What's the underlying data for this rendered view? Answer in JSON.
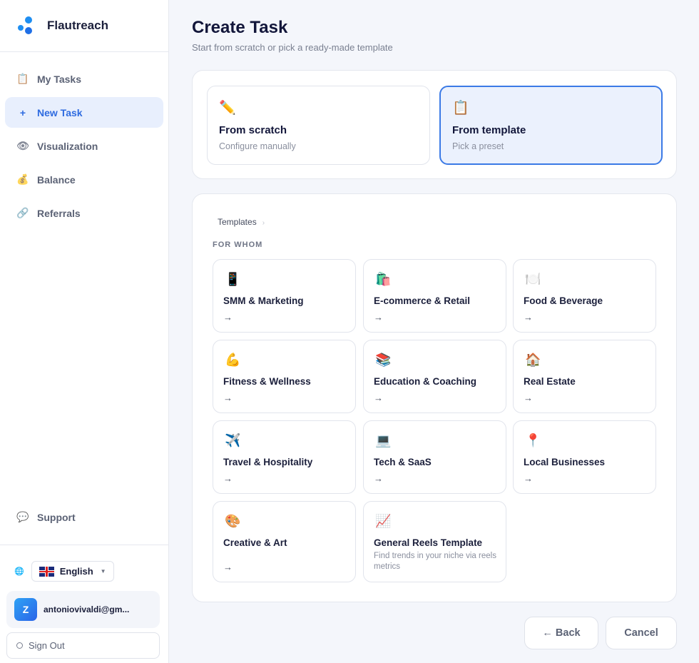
{
  "brand": {
    "name": "Flautreach"
  },
  "sidebar": {
    "items": [
      {
        "label": "My Tasks",
        "icon": "clipboard-icon",
        "glyph": "📋"
      },
      {
        "label": "New Task",
        "icon": "plus-icon",
        "glyph": "+"
      },
      {
        "label": "Visualization",
        "icon": "eye-icon",
        "glyph": "👁"
      },
      {
        "label": "Balance",
        "icon": "money-bag-icon",
        "glyph": "💰"
      },
      {
        "label": "Referrals",
        "icon": "link-icon",
        "glyph": "🔗"
      }
    ],
    "support": {
      "label": "Support",
      "glyph": "💬"
    },
    "language": {
      "selected": "English",
      "globe": "🌐"
    },
    "user": {
      "initial": "Z",
      "email": "antoniovivaldi@gm..."
    },
    "sign_out": "Sign Out"
  },
  "header": {
    "title": "Create Task",
    "subtitle": "Start from scratch or pick a ready-made template"
  },
  "modes": {
    "scratch": {
      "title": "From scratch",
      "desc": "Configure manually",
      "glyph": "✏️"
    },
    "template": {
      "title": "From template",
      "desc": "Pick a preset",
      "glyph": "📋"
    }
  },
  "templates": {
    "breadcrumb": "Templates",
    "breadcrumb_sep": "›",
    "section_label": "FOR WHOM",
    "arrow": "→",
    "cards": [
      {
        "title": "SMM & Marketing",
        "glyph": "📱",
        "icon": "phone-icon"
      },
      {
        "title": "E-commerce & Retail",
        "glyph": "🛍️",
        "icon": "shopping-bag-icon"
      },
      {
        "title": "Food & Beverage",
        "glyph": "🍽️",
        "icon": "plate-icon"
      },
      {
        "title": "Fitness & Wellness",
        "glyph": "💪",
        "icon": "muscle-icon"
      },
      {
        "title": "Education & Coaching",
        "glyph": "📚",
        "icon": "books-icon"
      },
      {
        "title": "Real Estate",
        "glyph": "🏠",
        "icon": "house-icon"
      },
      {
        "title": "Travel & Hospitality",
        "glyph": "✈️",
        "icon": "airplane-icon"
      },
      {
        "title": "Tech & SaaS",
        "glyph": "💻",
        "icon": "laptop-icon"
      },
      {
        "title": "Local Businesses",
        "glyph": "📍",
        "icon": "pin-icon"
      },
      {
        "title": "Creative & Art",
        "glyph": "🎨",
        "icon": "palette-icon"
      },
      {
        "title": "General Reels Template",
        "glyph": "📈",
        "icon": "chart-up-icon",
        "desc": "Find trends in your niche via reels metrics"
      }
    ]
  },
  "footer": {
    "back": "← Back",
    "cancel": "Cancel"
  },
  "colors": {
    "accent": "#2e6be0",
    "selected_border": "#3b7ae6",
    "selected_bg": "#ebf1fd"
  }
}
